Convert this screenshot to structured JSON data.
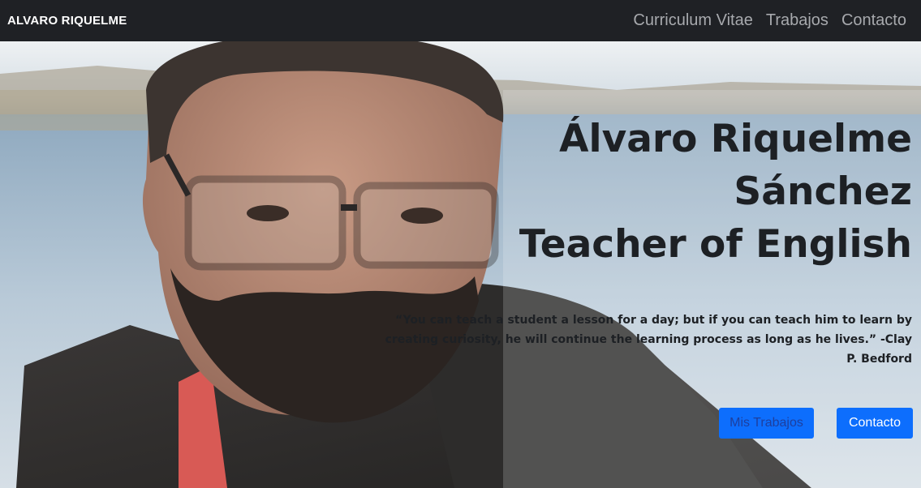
{
  "navbar": {
    "brand": "ALVARO RIQUELME",
    "links": [
      "Curriculum Vitae",
      "Trabajos",
      "Contacto"
    ]
  },
  "hero": {
    "title_lines": [
      "Álvaro Riquelme",
      "Sánchez",
      "Teacher of English"
    ],
    "quote": "“You can teach a student a lesson for a day; but if you can teach him to learn by creating curiosity, he will continue the learning process as long as he lives.” -Clay P. Bedford",
    "buttons": {
      "works": "Mis Trabajos",
      "contact": "Contacto"
    }
  },
  "colors": {
    "navbar_bg": "#1f2125",
    "nav_link": "#a7a9ad",
    "primary_button": "#0d6efd",
    "heading_text": "#1d2024"
  }
}
